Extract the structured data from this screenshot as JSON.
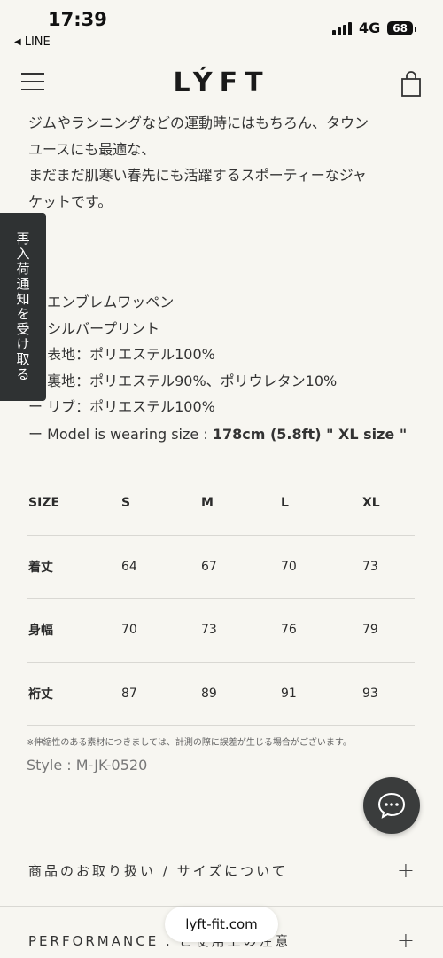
{
  "status": {
    "time": "17:39",
    "back_app": "LINE",
    "network": "4G",
    "battery": "68"
  },
  "header": {
    "logo": "LÝFT"
  },
  "side_tab": {
    "label": "再入荷通知を受け取る"
  },
  "description": {
    "lines": [
      "ジムやランニングなどの運動時にはもちろん、タウン",
      "ユースにも最適な、",
      "まだまだ肌寒い春先にも活躍するスポーティーなジャ",
      "ケットです。"
    ]
  },
  "features": [
    "ー エンブレムワッペン",
    "ー シルバープリント",
    "ー 表地：ポリエステル100%",
    "ー 裏地：ポリエステル90%、ポリウレタン10%",
    "ー リブ：ポリエステル100%"
  ],
  "model": {
    "prefix": "ー Model is wearing size : ",
    "height": "178cm (5.8ft)",
    "size": " \" XL size \""
  },
  "size_table": {
    "headers": [
      "SIZE",
      "S",
      "M",
      "L",
      "XL"
    ],
    "rows": [
      [
        "着丈",
        "64",
        "67",
        "70",
        "73"
      ],
      [
        "身幅",
        "70",
        "73",
        "76",
        "79"
      ],
      [
        "裄丈",
        "87",
        "89",
        "91",
        "93"
      ]
    ]
  },
  "note": "※伸縮性のある素材につきましては、計測の際に誤差が生じる場合がございます。",
  "style_code": "Style : M-JK-0520",
  "accordions": [
    {
      "label": "商品のお取り扱い / サイズについて",
      "icon": "+"
    },
    {
      "label": "PERFORMANCE . ご使用上の注意",
      "icon": "+"
    }
  ],
  "url": "lyft-fit.com",
  "icons": {
    "menu": "hamburger-menu-icon",
    "bag": "shopping-bag-icon",
    "chat": "chat-bubble-icon"
  }
}
